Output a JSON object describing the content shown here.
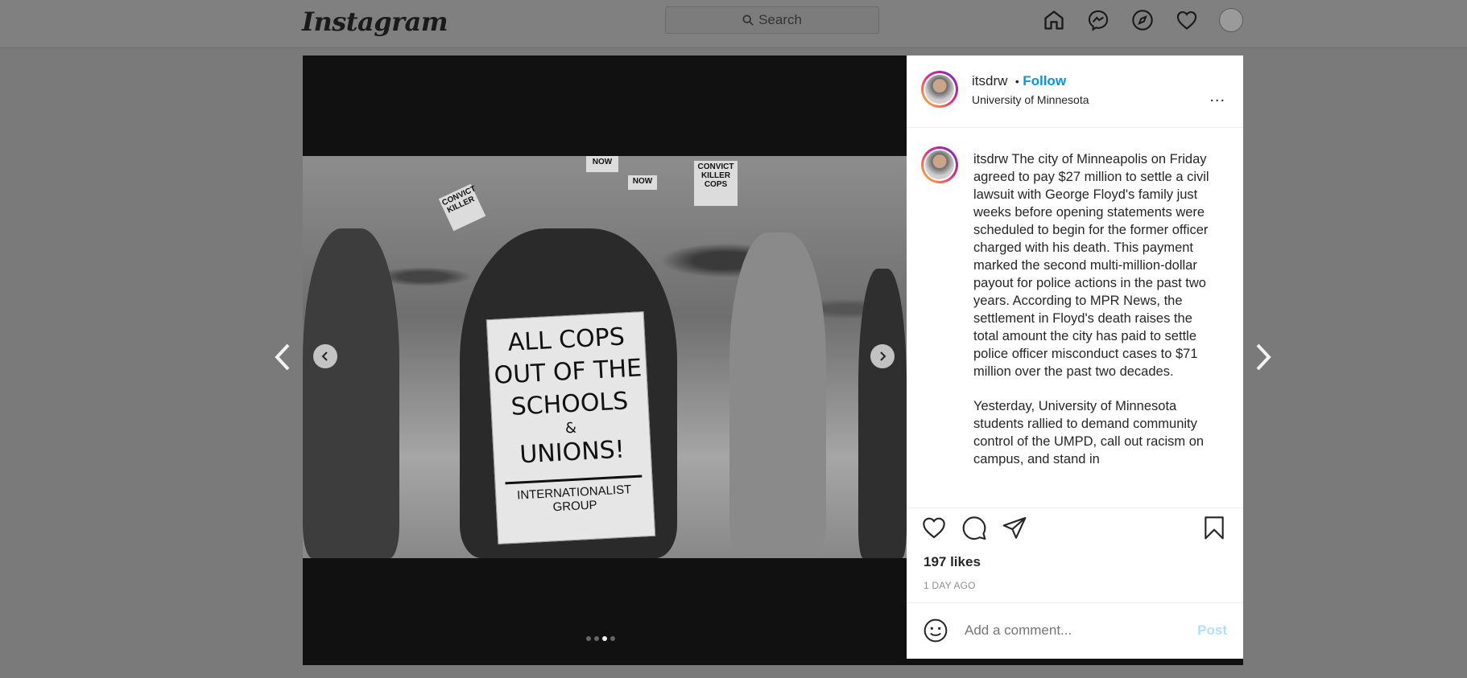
{
  "nav": {
    "logo": "Instagram",
    "search_placeholder": "Search",
    "icons": [
      "home-icon",
      "messenger-icon",
      "explore-icon",
      "heart-icon",
      "profile-avatar"
    ]
  },
  "post": {
    "username": "itsdrw",
    "follow_separator": "•",
    "follow_label": "Follow",
    "location": "University of Minnesota",
    "more_label": "...",
    "caption_username": "itsdrw",
    "caption_paragraph_1": "The city of Minneapolis on Friday agreed to pay $27 million to settle a civil lawsuit with George Floyd's family just weeks before opening statements were scheduled to begin for the former officer charged with his death. This payment marked the second multi-million-dollar payout for police actions in the past two years. According to MPR News, the settlement in Floyd's death raises the total amount the city has paid to settle police officer misconduct cases to $71 million over the past two decades.",
    "caption_paragraph_2": "Yesterday, University of Minnesota students rallied to demand community control of the UMPD, call out racism on campus, and stand in",
    "likes": "197 likes",
    "date": "1 DAY AGO",
    "comment_placeholder": "Add a comment...",
    "post_button": "Post"
  },
  "photo": {
    "sign_lines": [
      "ALL COPS",
      "OUT OF THE",
      "SCHOOLS",
      "&",
      "UNIONS!"
    ],
    "sign_footer": "INTERNATIONALIST GROUP",
    "small_signs": [
      "NOW",
      "CONVICT KILLER COPS",
      "CONVICT KILLER",
      "NOW"
    ]
  },
  "carousel": {
    "total_slides": 4,
    "active_slide": 3
  },
  "colors": {
    "accent": "#0095f6",
    "post_disabled": "#b2dffc",
    "overlay_bg": "#7a7a7a"
  }
}
